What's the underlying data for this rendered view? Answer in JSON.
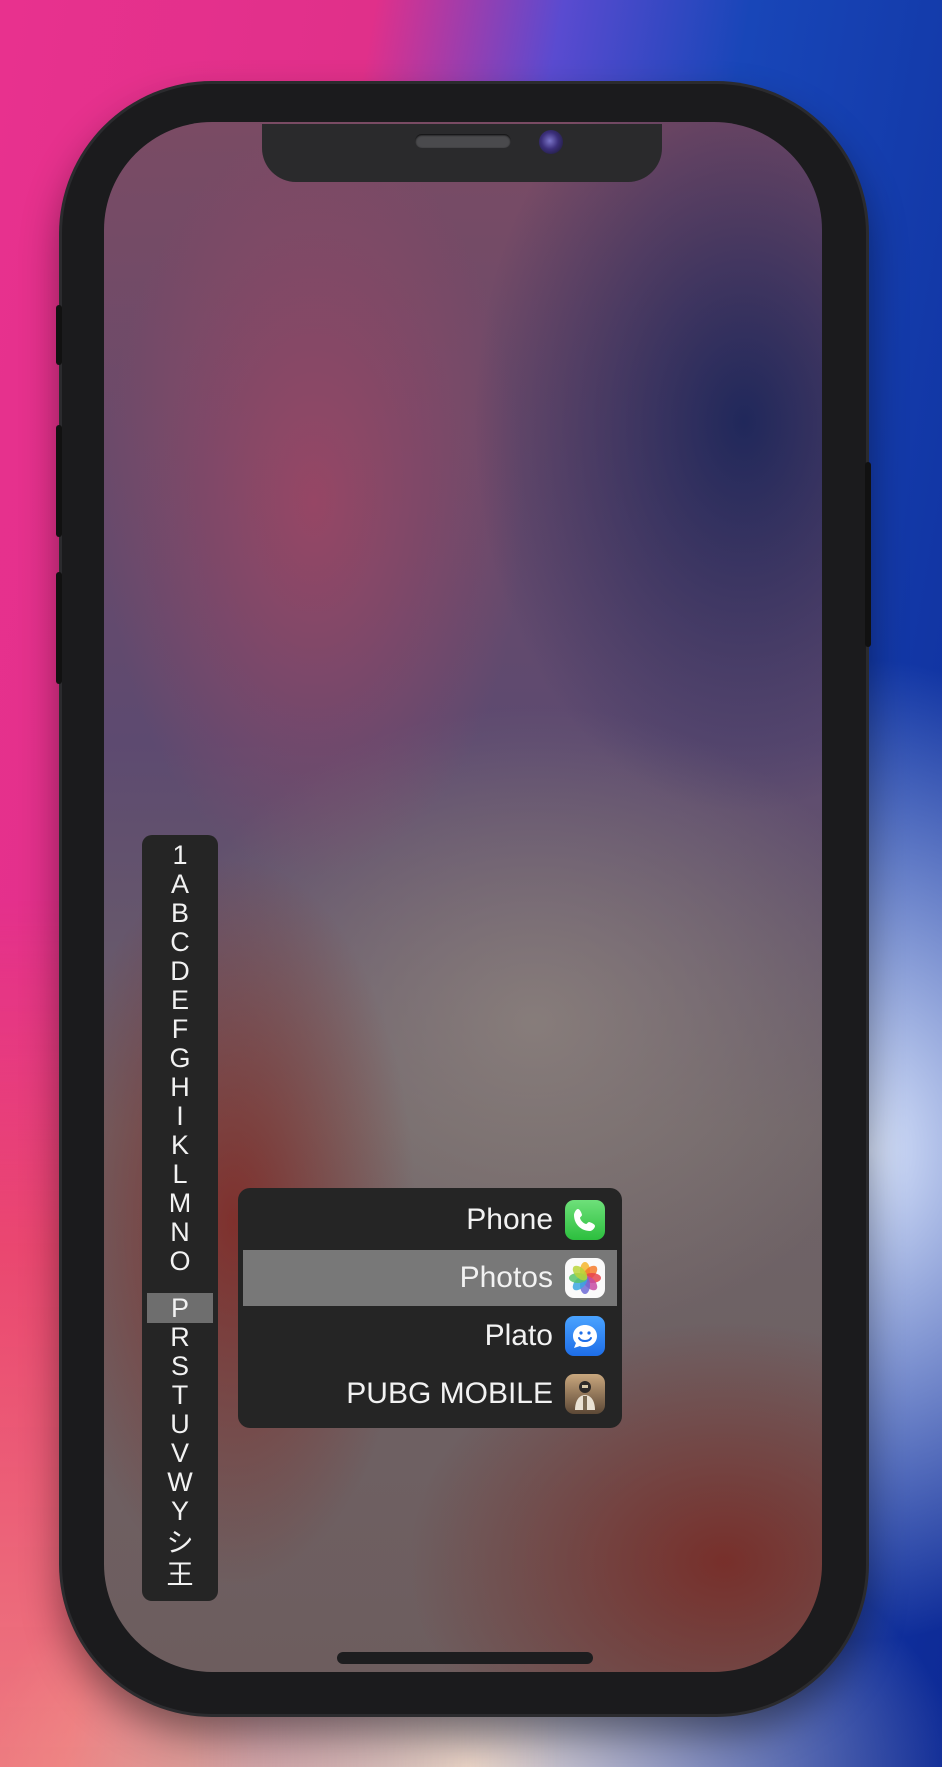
{
  "index_bar": {
    "letters": [
      "1",
      "A",
      "B",
      "C",
      "D",
      "E",
      "F",
      "G",
      "H",
      "I",
      "K",
      "L",
      "M",
      "N",
      "O",
      "P",
      "R",
      "S",
      "T",
      "U",
      "V",
      "W",
      "Y",
      "シ",
      "王"
    ],
    "active": "P"
  },
  "app_list": {
    "items": [
      {
        "label": "Phone",
        "icon": "phone-icon",
        "selected": false
      },
      {
        "label": "Photos",
        "icon": "photos-icon",
        "selected": true
      },
      {
        "label": "Plato",
        "icon": "plato-icon",
        "selected": false
      },
      {
        "label": "PUBG MOBILE",
        "icon": "pubg-mobile-icon",
        "selected": false
      }
    ]
  },
  "colors": {
    "panel": "#252525",
    "highlight": "#787878",
    "text": "#f2f2f2"
  }
}
